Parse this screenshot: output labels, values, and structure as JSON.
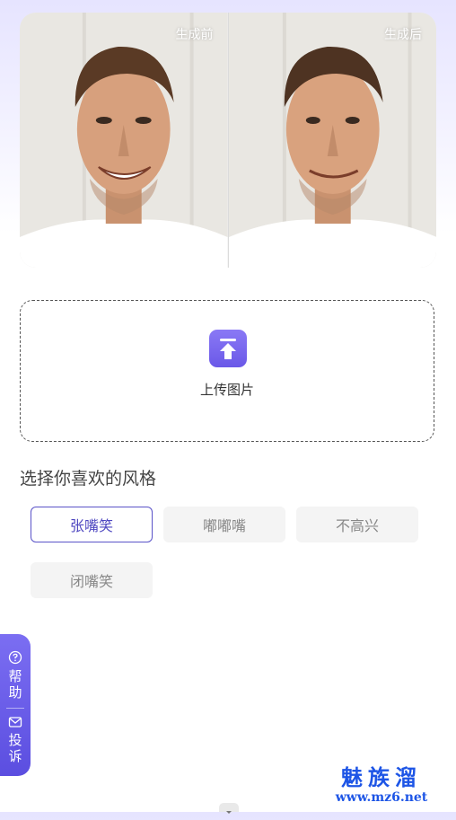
{
  "comparison": {
    "before_label": "生成前",
    "after_label": "生成后"
  },
  "upload": {
    "label": "上传图片",
    "icon": "upload-arrow-icon"
  },
  "styles": {
    "title": "选择你喜欢的风格",
    "options": [
      {
        "label": "张嘴笑",
        "selected": true
      },
      {
        "label": "嘟嘟嘴",
        "selected": false
      },
      {
        "label": "不高兴",
        "selected": false
      },
      {
        "label": "闭嘴笑",
        "selected": false
      }
    ]
  },
  "side_tab": {
    "help_icon": "question-circle-icon",
    "help_label": "帮助",
    "feedback_icon": "mail-icon",
    "feedback_label": "投诉"
  },
  "watermark": {
    "title": "魅族溜",
    "url": "www.mz6.net"
  },
  "colors": {
    "accent": "#5a53c8",
    "upload_icon_bg": "#7a68f0",
    "side_tab_bg": "#6b5eea",
    "watermark": "#1d55e6"
  }
}
